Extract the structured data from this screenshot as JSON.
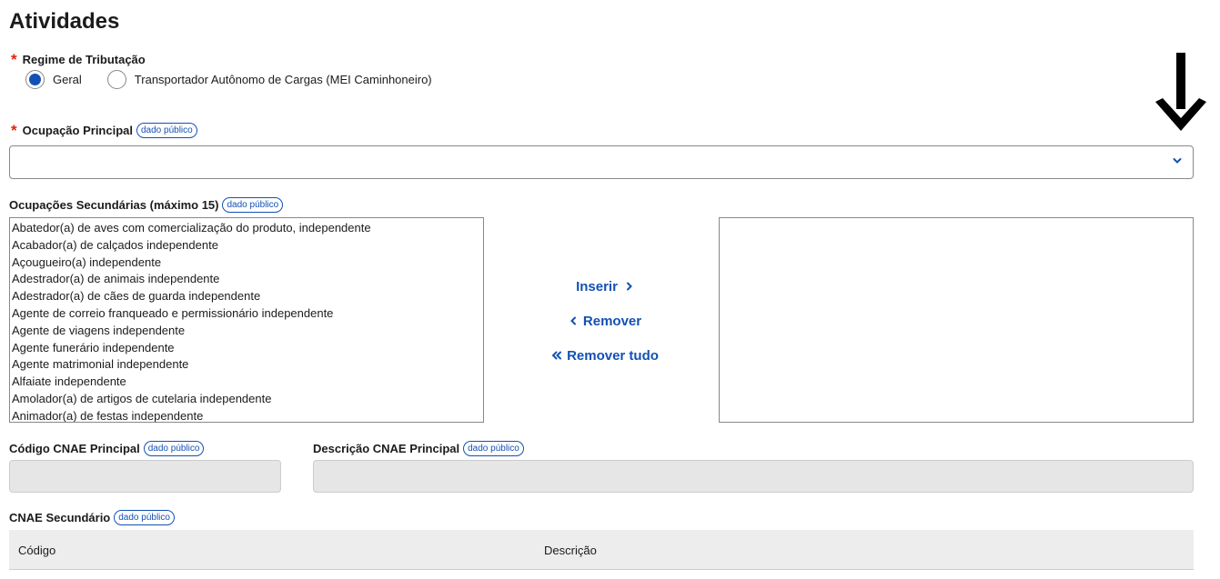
{
  "page": {
    "title": "Atividades"
  },
  "regime": {
    "label": "Regime de Tributação",
    "required_mark": "*",
    "options": [
      {
        "label": "Geral",
        "selected": true
      },
      {
        "label": "Transportador Autônomo de Cargas (MEI Caminhoneiro)",
        "selected": false
      }
    ]
  },
  "public_badge": "dado público",
  "ocupacao_principal": {
    "label": "Ocupação Principal",
    "value": ""
  },
  "ocupacoes_secundarias": {
    "label": "Ocupações Secundárias (máximo 15)",
    "available": [
      "Abatedor(a) de aves com comercialização do produto, independente",
      "Acabador(a) de calçados independente",
      "Açougueiro(a) independente",
      "Adestrador(a) de animais independente",
      "Adestrador(a) de cães de guarda independente",
      "Agente de correio franqueado e permissionário independente",
      "Agente de viagens independente",
      "Agente funerário independente",
      "Agente matrimonial independente",
      "Alfaiate independente",
      "Amolador(a) de artigos de cutelaria independente",
      "Animador(a) de festas independente"
    ],
    "selected": []
  },
  "actions": {
    "insert": "Inserir",
    "remove": "Remover",
    "remove_all": "Remover tudo"
  },
  "cnae_principal": {
    "code_label": "Código CNAE Principal",
    "desc_label": "Descrição CNAE Principal"
  },
  "cnae_secundario": {
    "label": "CNAE Secundário",
    "columns": [
      "Código",
      "Descrição"
    ]
  },
  "colors": {
    "accent": "#1351b4",
    "required": "#e52207",
    "disabled_bg": "#e6e6e6"
  }
}
